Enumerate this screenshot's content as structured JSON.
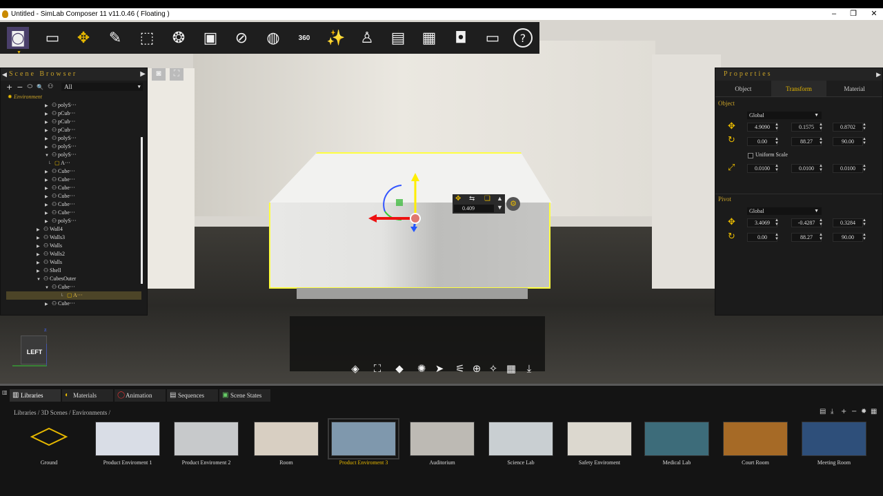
{
  "window": {
    "title": "Untitled - SimLab Composer 11 v11.0.46 ( Floating )",
    "minimize": "–",
    "maximize": "❐",
    "close": "✕"
  },
  "toolbar": {
    "icons": [
      "vr-headset-icon",
      "open-file-icon",
      "move-icon",
      "edit-icon",
      "select-rect-icon",
      "materials-icon",
      "camera-icon",
      "no-render-icon",
      "globe-icon",
      "360-icon",
      "magic-wand-icon",
      "lamp-icon",
      "presentation-icon",
      "grid-icon",
      "vr-goggles-icon",
      "monitor-user-icon",
      "help-icon"
    ],
    "glyphs": [
      "◙",
      "▭",
      "✥",
      "✎",
      "⬚",
      "❂",
      "▣",
      "⊘",
      "◍",
      "360",
      "✨",
      "♙",
      "▤",
      "▦",
      "◘",
      "▭",
      "?"
    ]
  },
  "scene_browser": {
    "title": "Scene Browser",
    "tool_glyphs": [
      "+",
      "−",
      "⬭",
      "🔍",
      "⚇"
    ],
    "filter": "All",
    "root": "Environment",
    "nodes": [
      {
        "label": "polyS···",
        "depth": 2,
        "twisty": "▶"
      },
      {
        "label": "pCub···",
        "depth": 2,
        "twisty": "▶"
      },
      {
        "label": "pCub···",
        "depth": 2,
        "twisty": "▶"
      },
      {
        "label": "pCub···",
        "depth": 2,
        "twisty": "▶"
      },
      {
        "label": "polyS···",
        "depth": 2,
        "twisty": "▶"
      },
      {
        "label": "polyS···",
        "depth": 2,
        "twisty": "▶"
      },
      {
        "label": "polyS···",
        "depth": 2,
        "twisty": "▼"
      },
      {
        "label": "A···",
        "depth": 3,
        "twisty": ""
      },
      {
        "label": "Cube···",
        "depth": 2,
        "twisty": "▶"
      },
      {
        "label": "Cube···",
        "depth": 2,
        "twisty": "▶"
      },
      {
        "label": "Cube···",
        "depth": 2,
        "twisty": "▶"
      },
      {
        "label": "Cube···",
        "depth": 2,
        "twisty": "▶"
      },
      {
        "label": "Cube···",
        "depth": 2,
        "twisty": "▶"
      },
      {
        "label": "Cube···",
        "depth": 2,
        "twisty": "▶"
      },
      {
        "label": "polyS···",
        "depth": 2,
        "twisty": "▶"
      },
      {
        "label": "Wall4",
        "depth": 1,
        "twisty": "▶"
      },
      {
        "label": "Walls3",
        "depth": 1,
        "twisty": "▶"
      },
      {
        "label": "Walls",
        "depth": 1,
        "twisty": "▶"
      },
      {
        "label": "Walls2",
        "depth": 1,
        "twisty": "▶"
      },
      {
        "label": "Walls",
        "depth": 1,
        "twisty": "▶"
      },
      {
        "label": "Shell",
        "depth": 1,
        "twisty": "▶"
      },
      {
        "label": "CubesOuter",
        "depth": 1,
        "twisty": "▼"
      },
      {
        "label": "Cube···",
        "depth": 2,
        "twisty": "▼"
      },
      {
        "label": "A···",
        "depth": 3,
        "twisty": "",
        "selected": true
      },
      {
        "label": "Cube···",
        "depth": 2,
        "twisty": "▶"
      }
    ]
  },
  "properties": {
    "title": "Properties",
    "tabs": [
      "Object",
      "Transform",
      "Material"
    ],
    "active_tab": "Transform",
    "object_section": "Object",
    "object_space": "Global",
    "position": [
      "4.9090",
      "0.1575",
      "0.8702"
    ],
    "rotation": [
      "0.00",
      "88.27",
      "90.00"
    ],
    "uniform_scale": "Uniform Scale",
    "scale": [
      "0.0100",
      "0.0100",
      "0.0100"
    ],
    "pivot_section": "Pivot",
    "pivot_space": "Global",
    "pivot_position": [
      "3.4069",
      "-0.4287",
      "0.3284"
    ],
    "pivot_rotation": [
      "0.00",
      "88.27",
      "90.00"
    ]
  },
  "viewport": {
    "gizmo_value": "0.409",
    "nav_cube_label": "LEFT",
    "axis_z": "z",
    "bottom_tools": [
      "◈",
      "⛶",
      "◆",
      "✺",
      "➤",
      "⚟",
      "⊕",
      "✧",
      "▦",
      "⤓"
    ]
  },
  "library": {
    "tabs": [
      {
        "label": "Libraries",
        "icon": "▥"
      },
      {
        "label": "Materials",
        "icon": "◐"
      },
      {
        "label": "Animation",
        "icon": "◯"
      },
      {
        "label": "Sequences",
        "icon": "▤"
      },
      {
        "label": "Scene States",
        "icon": "▣"
      }
    ],
    "active_tab": "Libraries",
    "breadcrumb": "Libraries  /  3D Scenes  /  Environments  /",
    "items": [
      {
        "label": "Ground",
        "color": "#141414"
      },
      {
        "label": "Product Enviroment 1",
        "color": "#d9dde6"
      },
      {
        "label": "Product Enviroment 2",
        "color": "#c7c9cb"
      },
      {
        "label": "Room",
        "color": "#d8cfc2"
      },
      {
        "label": "Product Enviroment 3",
        "color": "#7f98ad",
        "selected": true
      },
      {
        "label": "Auditorium",
        "color": "#bdbab4"
      },
      {
        "label": "Science Lab",
        "color": "#c9cfd2"
      },
      {
        "label": "Safety Enviroment",
        "color": "#dcd8cf"
      },
      {
        "label": "Medical Lab",
        "color": "#3d6c7a"
      },
      {
        "label": "Court Room",
        "color": "#a66a26"
      },
      {
        "label": "Meeting Room",
        "color": "#2e4f7a"
      }
    ],
    "tool_glyphs": [
      "▤",
      "⤓",
      "+",
      "−",
      "✹",
      "▦"
    ]
  }
}
